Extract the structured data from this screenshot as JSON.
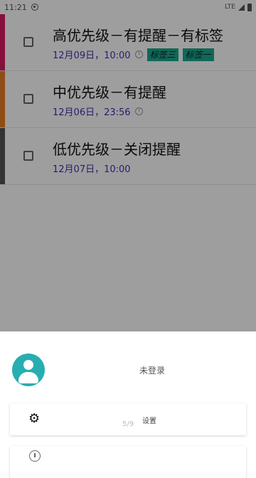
{
  "status_bar": {
    "time": "11:21",
    "network": "LTE"
  },
  "todos": [
    {
      "title": "高优先级－有提醒－有标签",
      "date": "12月09日，10:00",
      "has_alarm": true,
      "tags": [
        "标签三",
        "标签一"
      ],
      "priority_color": "#d81b60"
    },
    {
      "title": "中优先级－有提醒",
      "date": "12月06日，23:56",
      "has_alarm": true,
      "tags": [],
      "priority_color": "#e67e22"
    },
    {
      "title": "低优先级－关闭提醒",
      "date": "12月07日，10:00",
      "has_alarm": false,
      "tags": [],
      "priority_color": "#555555"
    }
  ],
  "sheet": {
    "login_text": "未登录",
    "menu": [
      {
        "label": "设置",
        "icon": "gear-icon"
      },
      {
        "label": "",
        "icon": "info-icon"
      }
    ],
    "page_indicator": "5/9"
  },
  "colors": {
    "accent": "#27aeb0",
    "date": "#4b2bb0",
    "tag_bg": "#1aa98f"
  }
}
